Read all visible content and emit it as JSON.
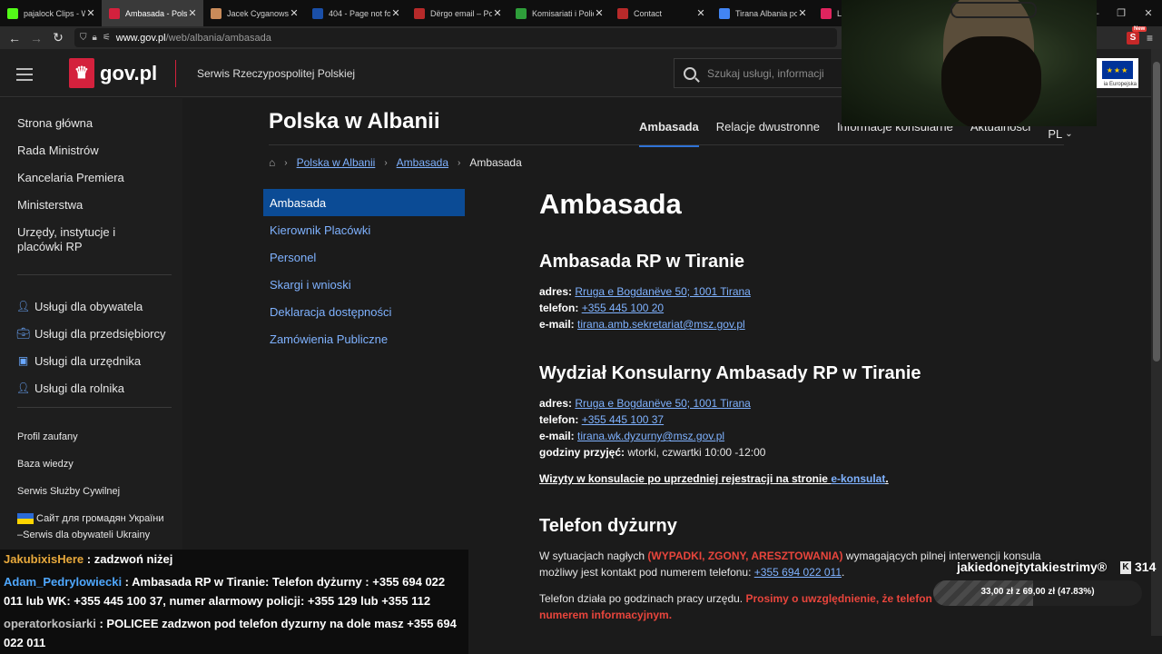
{
  "browser": {
    "tabs": [
      {
        "title": "pajalock Clips - W",
        "color": "#53fc18"
      },
      {
        "title": "Ambasada - Polsk",
        "color": "#d4213d",
        "active": true
      },
      {
        "title": "Jacek Cyganowski",
        "color": "#c98b5a"
      },
      {
        "title": "404 - Page not fo",
        "color": "#1a4fa8"
      },
      {
        "title": "Dërgo email – Po",
        "color": "#b72a2a"
      },
      {
        "title": "Komisariati i Polic",
        "color": "#2e9e3a"
      },
      {
        "title": "Contact",
        "color": "#b72a2a"
      },
      {
        "title": "Tirana Albania po",
        "color": "#4285f4"
      },
      {
        "title": "L",
        "color": "#e0245e"
      }
    ],
    "url_host": "www.gov.pl",
    "url_path": "/web/albania/ambasada",
    "ext_badge": "New",
    "ext_count": "4"
  },
  "header": {
    "brand": "gov.pl",
    "servis": "Serwis Rzeczypospolitej Polskiej",
    "search_placeholder": "Szukaj usługi, informacji",
    "eu_caption": "ia Europejska"
  },
  "sidebar": {
    "main_items": [
      "Strona główna",
      "Rada Ministrów",
      "Kancelaria Premiera",
      "Ministerstwa",
      "Urzędy, instytucje i placówki RP"
    ],
    "service_items": [
      "Usługi dla obywatela",
      "Usługi dla przedsiębiorcy",
      "Usługi dla urzędnika",
      "Usługi dla rolnika"
    ],
    "more_items": [
      "Profil zaufany",
      "Baza wiedzy",
      "Serwis Służby Cywilnej"
    ],
    "ukraine_line1": "Сайт для громадян України",
    "ukraine_line2": "–Serwis dla obywateli Ukrainy"
  },
  "site": {
    "title": "Polska w Albanii",
    "nav": [
      "Ambasada",
      "Relacje dwustronne",
      "Informacje konsularne",
      "Aktualności"
    ],
    "lang": "PL",
    "breadcrumbs": [
      "Polska w Albanii",
      "Ambasada"
    ],
    "breadcrumb_current": "Ambasada",
    "subnav": [
      "Ambasada",
      "Kierownik Placówki",
      "Personel",
      "Skargi i wnioski",
      "Deklaracja dostępności",
      "Zamówienia Publiczne"
    ]
  },
  "content": {
    "h1": "Ambasada",
    "s1": {
      "title": "Ambasada RP w Tiranie",
      "adres_label": "adres:",
      "adres": "Rruga e Bogdanëve 50; 1001 Tirana",
      "tel_label": "telefon:",
      "tel": "+355 445 100 20",
      "email_label": "e-mail:",
      "email": "tirana.amb.sekretariat@msz.gov.pl"
    },
    "s2": {
      "title": "Wydział Konsularny Ambasady RP w Tiranie",
      "adres_label": "adres:",
      "adres": "Rruga e Bogdanëve 50; 1001 Tirana",
      "tel_label": "telefon:",
      "tel": "+355 445 100 37",
      "email_label": "e-mail:",
      "email": "tirana.wk.dyzurny@msz.gov.pl",
      "hours_label": "godziny przyjęć:",
      "hours": "wtorki, czwartki 10:00 -12:00",
      "visit_text": "Wizyty w konsulacie po uprzedniej rejestracji na stronie ",
      "visit_link": "e-konsulat",
      "visit_end": "."
    },
    "s3": {
      "title": "Telefon dyżurny",
      "p1_a": "W sytuacjach nagłych ",
      "p1_red": "(WYPADKI, ZGONY, ARESZTOWANIA)",
      "p1_b": " wymagających pilnej interwencji konsula",
      "p1_c": "możliwy jest kontakt pod numerem telefonu: ",
      "p1_tel": "+355 694 022 011",
      "p1_end": ".",
      "p2_a": "Telefon działa po godzinach pracy urzędu. ",
      "p2_red": "Prosimy o uwzględnienie, że telefon dyżurny nie jest numerem informacyjnym."
    }
  },
  "chat": [
    {
      "user": "JakubixisHere",
      "text": " : zadzwoń niżej"
    },
    {
      "user": "Adam_Pedrylowiecki",
      "text": " : Ambasada RP w Tiranie: Telefon dyżurny : +355 694 022",
      "cont": "011 lub WK: +355 445 100 37, numer alarmowy policji: +355 129  lub +355 112"
    },
    {
      "user": "operatorkosiarki",
      "text": " : POLICEE zadzwon pod telefon dyzurny na dole masz +355 694",
      "cont": "022 011"
    }
  ],
  "goal": {
    "name": "jakiedonejtytakiestrimy®",
    "count": "314",
    "text": "33,00 zł z 69,00 zł (47.83%)",
    "progress_percent": 47.83
  }
}
